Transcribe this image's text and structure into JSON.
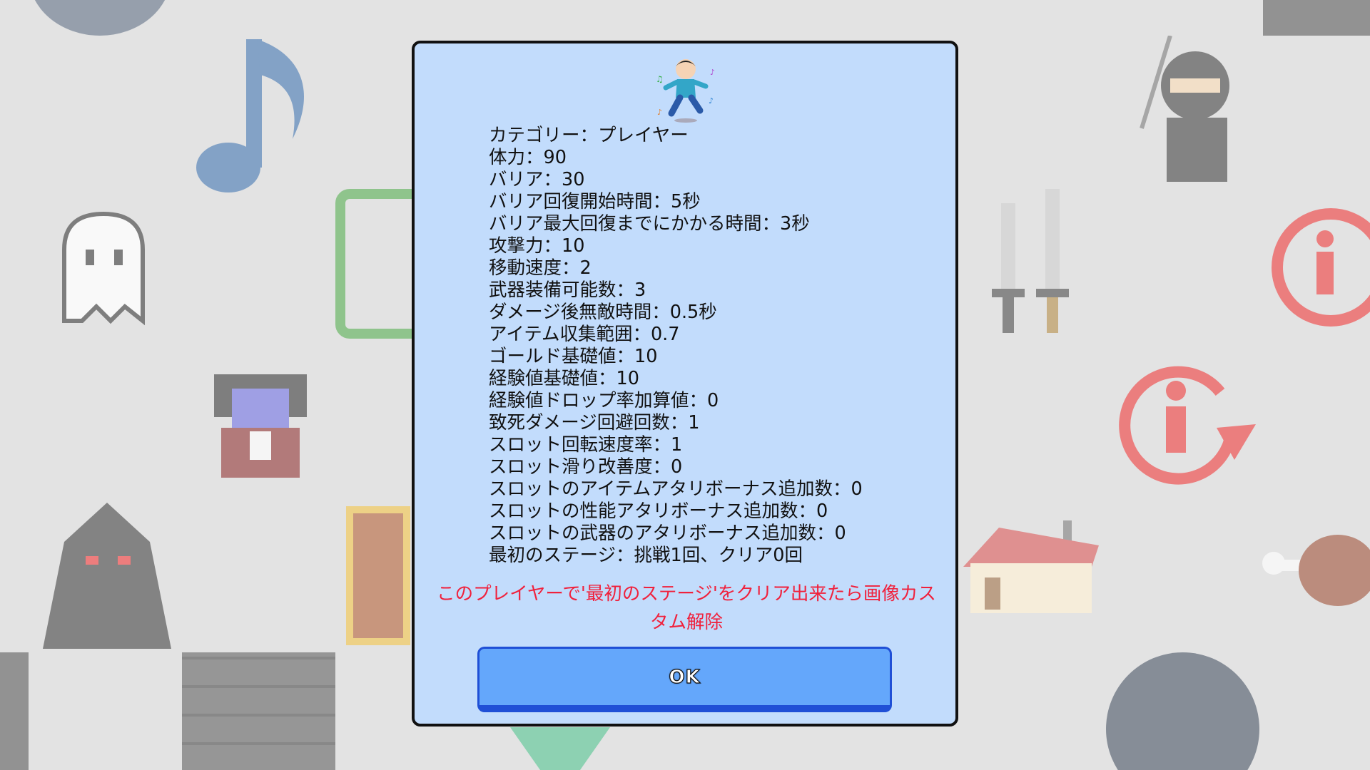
{
  "dialog": {
    "portrait_icon": "dancing-player-icon",
    "stats": [
      "カテゴリー：プレイヤー",
      "体力：90",
      "バリア：30",
      "バリア回復開始時間：5秒",
      "バリア最大回復までにかかる時間：3秒",
      "攻撃力：10",
      "移動速度：2",
      "武器装備可能数：3",
      "ダメージ後無敵時間：0.5秒",
      "アイテム収集範囲：0.7",
      "ゴールド基礎値：10",
      "経験値基礎値：10",
      "経験値ドロップ率加算値：0",
      "致死ダメージ回避回数：1",
      "スロット回転速度率：1",
      "スロット滑り改善度：0",
      "スロットのアイテムアタリボーナス追加数：0",
      "スロットの性能アタリボーナス追加数：0",
      "スロットの武器のアタリボーナス追加数：0",
      "最初のステージ：挑戦1回、クリア0回"
    ],
    "unlock_message": "このプレイヤーで'最初のステージ'をクリア出来たら画像カスタム解除",
    "ok_label": "OK"
  },
  "background_icons": [
    "circle-icon",
    "music-note-icon",
    "dice-icon",
    "ghost-icon",
    "vampire-icon",
    "hooded-figure-icon",
    "treasure-chest-icon",
    "brick-wall-icon",
    "ninja-icon",
    "swords-icon",
    "person-rotate-icon",
    "house-icon",
    "meat-icon",
    "crystal-icon"
  ],
  "colors": {
    "dialog_bg": "#c2dcfc",
    "message_red": "#f0213c",
    "button_blue": "#64a7fb",
    "button_border": "#1f4fd6"
  }
}
